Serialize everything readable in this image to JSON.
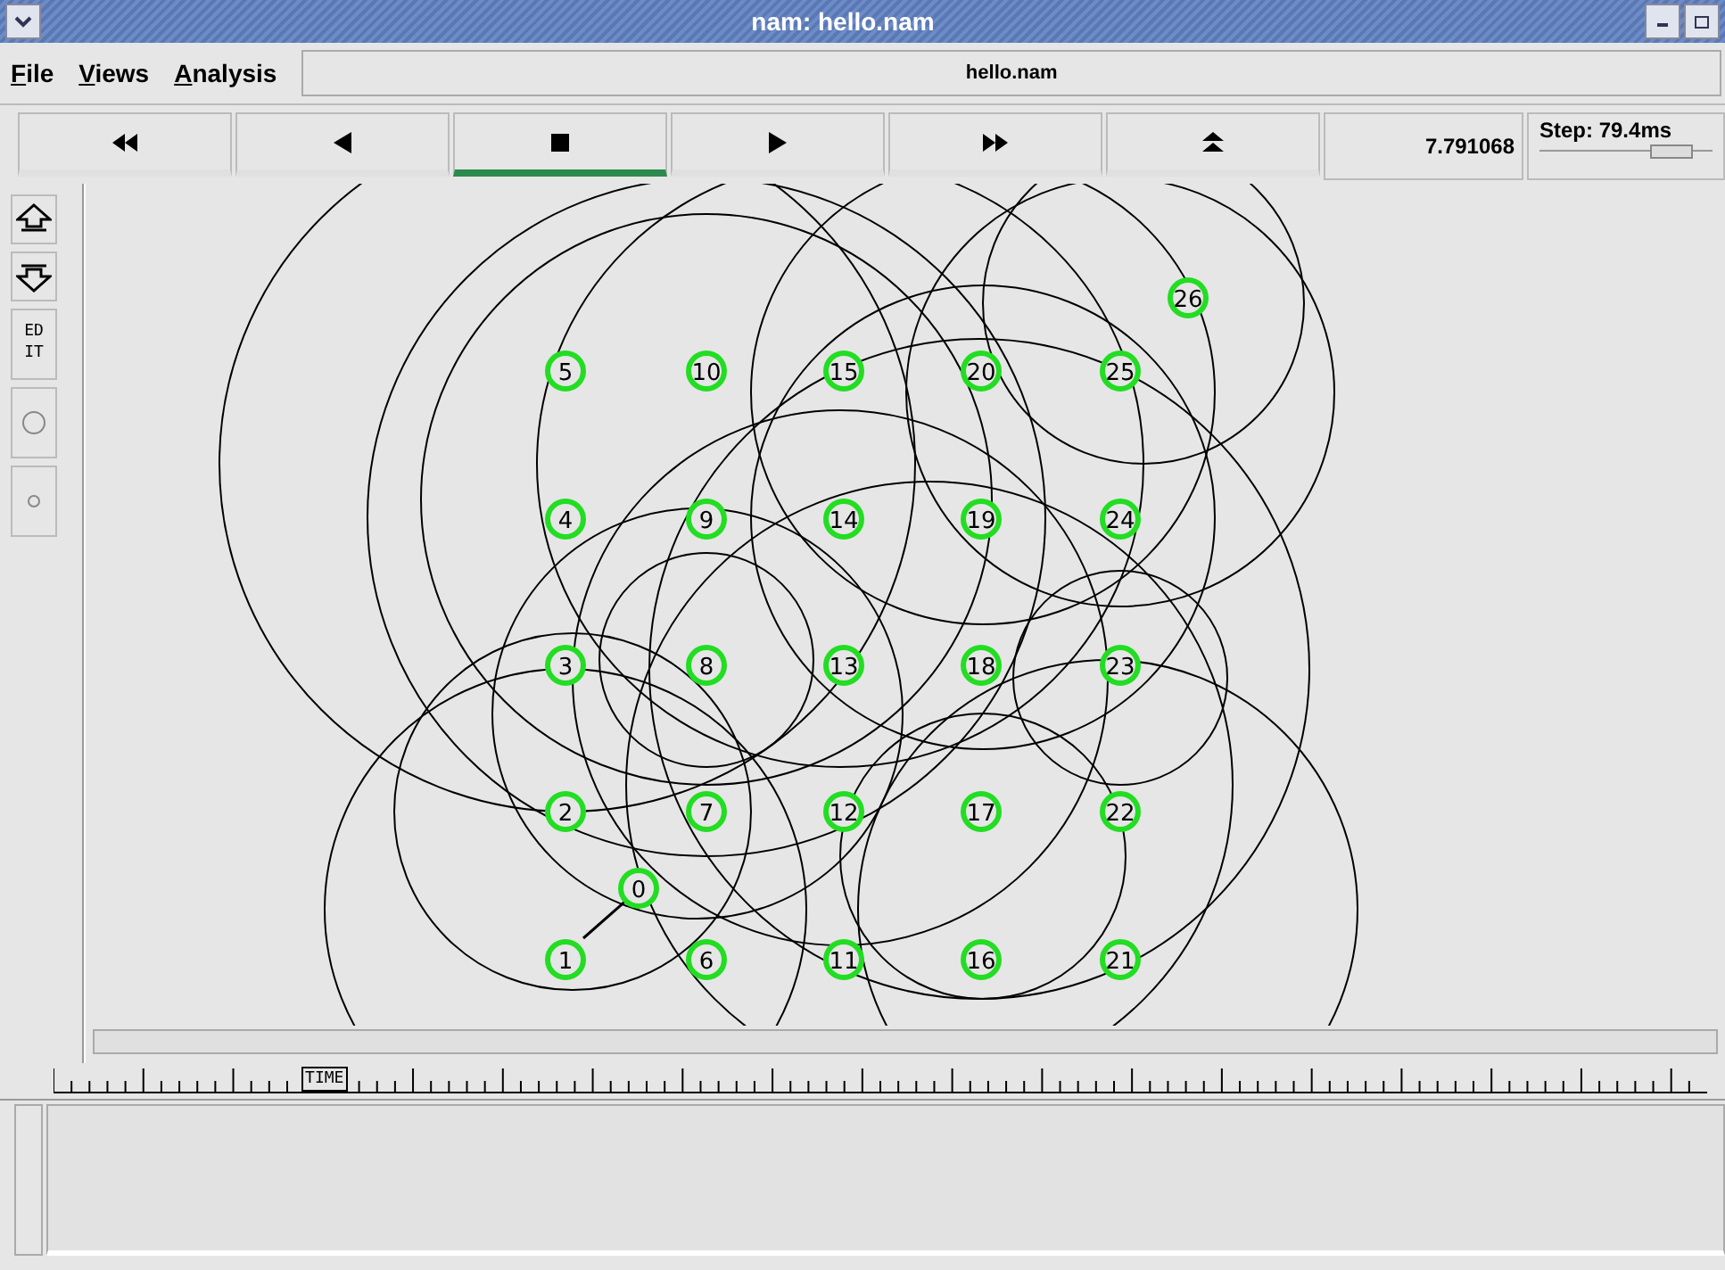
{
  "window": {
    "title": "nam: hello.nam"
  },
  "menu": [
    {
      "label": "File"
    },
    {
      "label": "Views"
    },
    {
      "label": "Analysis"
    }
  ],
  "file_label": "hello.nam",
  "controls": [
    {
      "kind": "rewind",
      "selected": false
    },
    {
      "kind": "back",
      "selected": false
    },
    {
      "kind": "stop",
      "selected": true
    },
    {
      "kind": "play",
      "selected": false
    },
    {
      "kind": "forward",
      "selected": false
    },
    {
      "kind": "eject",
      "selected": false
    }
  ],
  "time": "7.791068",
  "step": {
    "label": "Step: 79.4ms",
    "level": 0.75
  },
  "tools": [
    {
      "kind": "zoom-in"
    },
    {
      "kind": "zoom-out"
    },
    {
      "kind": "edit",
      "label": "ED IT"
    },
    {
      "kind": "big-circle"
    },
    {
      "kind": "small-circle"
    }
  ],
  "nodes": [
    "26",
    "5",
    "10",
    "15",
    "20",
    "25",
    "4",
    "9",
    "14",
    "19",
    "24",
    "3",
    "8",
    "13",
    "18",
    "23",
    "2",
    "7",
    "12",
    "17",
    "22",
    "0",
    "1",
    "6",
    "11",
    "16",
    "21"
  ],
  "timeline": {
    "marker": "TIME",
    "level": 0.15
  }
}
